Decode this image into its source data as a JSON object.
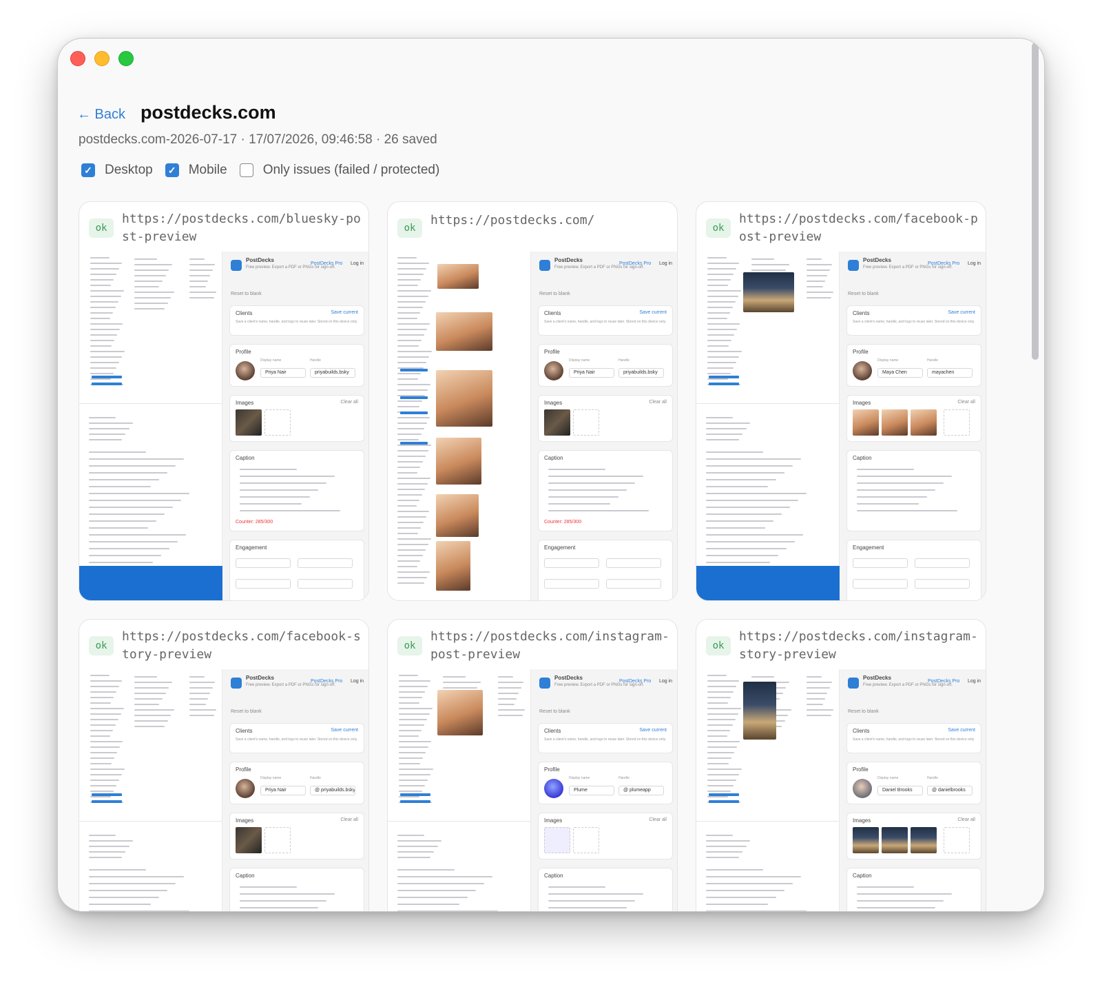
{
  "window": {
    "controls": [
      "close",
      "minimize",
      "maximize"
    ]
  },
  "header": {
    "back_label": "← Back",
    "title": "postdecks.com",
    "subtitle": "postdecks.com-2026-07-17 · 17/07/2026, 09:46:58 · 26 saved"
  },
  "filters": [
    {
      "label": "Desktop",
      "checked": true
    },
    {
      "label": "Mobile",
      "checked": true
    },
    {
      "label": "Only issues (failed / protected)",
      "checked": false
    }
  ],
  "cards": [
    {
      "status": "ok",
      "url": "https://postdecks.com/bluesky-post-preview",
      "variant": "editor",
      "thumb_images": "single",
      "profile_name": "Priya Nair",
      "profile_handle": "priyabuilds.bsky",
      "blue_footer": true
    },
    {
      "status": "ok",
      "url": "https://postdecks.com/",
      "variant": "home",
      "thumb_images": "single",
      "profile_name": "Priya Nair",
      "profile_handle": "priyabuilds.bsky",
      "blue_footer": false
    },
    {
      "status": "ok",
      "url": "https://postdecks.com/facebook-post-preview",
      "variant": "editor",
      "thumb_images": "multi",
      "profile_name": "Maya Chen",
      "profile_handle": "mayachen",
      "blue_footer": true
    },
    {
      "status": "ok",
      "url": "https://postdecks.com/facebook-story-preview",
      "variant": "editor",
      "thumb_images": "single",
      "profile_name": "Priya Nair",
      "profile_handle": "@ priyabuilds.bsky",
      "blue_footer": false
    },
    {
      "status": "ok",
      "url": "https://postdecks.com/instagram-post-preview",
      "variant": "editor",
      "thumb_images": "logo",
      "profile_name": "Plume",
      "profile_handle": "@ plumeapp",
      "blue_footer": false
    },
    {
      "status": "ok",
      "url": "https://postdecks.com/instagram-story-preview",
      "variant": "editor",
      "thumb_images": "multi-house",
      "profile_name": "Daniel Brooks",
      "profile_handle": "@ danielbrooks",
      "blue_footer": false
    }
  ],
  "mini": {
    "brand": "PostDecks",
    "tagline": "Free preview. Export a PDF or PNGs for sign-off.",
    "pro_link": "PostDecks Pro",
    "login": "Log in",
    "reset": "Reset to blank",
    "clients_title": "Clients",
    "save_current": "Save current",
    "clients_desc": "Save a client's name, handle, and logo to reuse later. Stored on this device only.",
    "profile_title": "Profile",
    "display_name_label": "Display name",
    "handle_label": "Handle",
    "images_title": "Images",
    "clear_all": "Clear all",
    "caption_title": "Caption",
    "engagement_title": "Engagement",
    "counter": "Counter: 285/300",
    "add_symbol": "+"
  }
}
